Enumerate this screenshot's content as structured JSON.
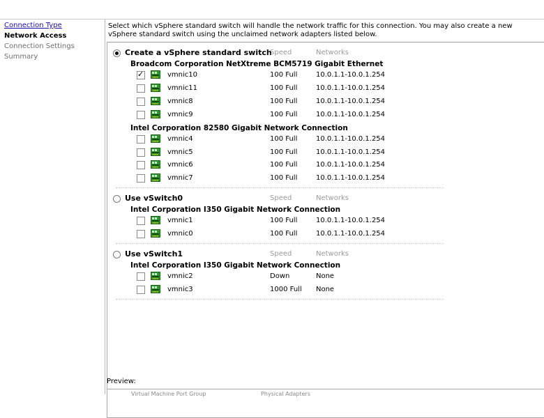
{
  "nav": [
    {
      "label": "Connection Type",
      "state": "link"
    },
    {
      "label": "Network Access",
      "state": "active"
    },
    {
      "label": "Connection Settings",
      "state": "muted"
    },
    {
      "label": "Summary",
      "state": "muted"
    }
  ],
  "instructions": "Select which vSphere standard switch will handle the network traffic for this connection. You may also create a new vSphere standard switch using the unclaimed network adapters listed below.",
  "columns": {
    "speed": "Speed",
    "networks": "Networks"
  },
  "groups": [
    {
      "label": "Create a vSphere standard switch",
      "selected": true,
      "vendors": [
        {
          "name": "Broadcom Corporation NetXtreme BCM5719 Gigabit Ethernet",
          "nics": [
            {
              "name": "vmnic10",
              "checked": true,
              "speed": "100 Full",
              "networks": "10.0.1.1-10.0.1.254"
            },
            {
              "name": "vmnic11",
              "checked": false,
              "speed": "100 Full",
              "networks": "10.0.1.1-10.0.1.254"
            },
            {
              "name": "vmnic8",
              "checked": false,
              "speed": "100 Full",
              "networks": "10.0.1.1-10.0.1.254"
            },
            {
              "name": "vmnic9",
              "checked": false,
              "speed": "100 Full",
              "networks": "10.0.1.1-10.0.1.254"
            }
          ]
        },
        {
          "name": "Intel Corporation 82580 Gigabit Network Connection",
          "nics": [
            {
              "name": "vmnic4",
              "checked": false,
              "speed": "100 Full",
              "networks": "10.0.1.1-10.0.1.254"
            },
            {
              "name": "vmnic5",
              "checked": false,
              "speed": "100 Full",
              "networks": "10.0.1.1-10.0.1.254"
            },
            {
              "name": "vmnic6",
              "checked": false,
              "speed": "100 Full",
              "networks": "10.0.1.1-10.0.1.254"
            },
            {
              "name": "vmnic7",
              "checked": false,
              "speed": "100 Full",
              "networks": "10.0.1.1-10.0.1.254"
            }
          ]
        }
      ]
    },
    {
      "label": "Use vSwitch0",
      "selected": false,
      "vendors": [
        {
          "name": "Intel Corporation I350 Gigabit Network Connection",
          "nics": [
            {
              "name": "vmnic1",
              "checked": false,
              "speed": "100 Full",
              "networks": "10.0.1.1-10.0.1.254"
            },
            {
              "name": "vmnic0",
              "checked": false,
              "speed": "100 Full",
              "networks": "10.0.1.1-10.0.1.254"
            }
          ]
        }
      ]
    },
    {
      "label": "Use vSwitch1",
      "selected": false,
      "vendors": [
        {
          "name": "Intel Corporation I350 Gigabit Network Connection",
          "nics": [
            {
              "name": "vmnic2",
              "checked": false,
              "speed": "Down",
              "networks": "None"
            },
            {
              "name": "vmnic3",
              "checked": false,
              "speed": "1000 Full",
              "networks": "None"
            }
          ]
        }
      ]
    }
  ],
  "preview": {
    "label": "Preview:",
    "col1": "Virtual Machine Port Group",
    "col2": "Physical Adapters"
  },
  "colors": {
    "nic_green": "#2e9a2e",
    "link": "#1a0dab",
    "muted": "#6e6e6e"
  }
}
